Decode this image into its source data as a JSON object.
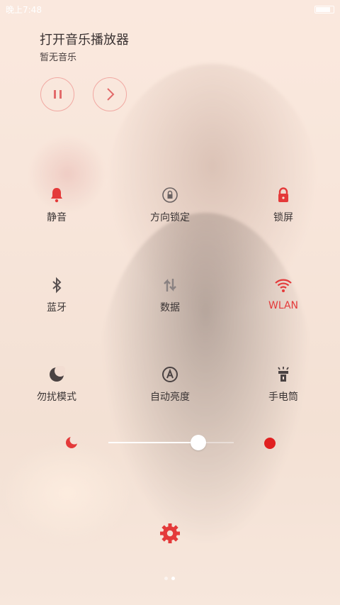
{
  "status_bar": {
    "time": "晚上7:48"
  },
  "music": {
    "title": "打开音乐播放器",
    "subtitle": "暂无音乐",
    "pause_icon": "pause-icon",
    "next_icon": "chevron-right-icon"
  },
  "tiles": [
    {
      "label": "静音",
      "icon": "bell-icon",
      "active": false
    },
    {
      "label": "方向锁定",
      "icon": "rotation-lock-icon",
      "active": false
    },
    {
      "label": "锁屏",
      "icon": "lock-icon",
      "active": false
    },
    {
      "label": "蓝牙",
      "icon": "bluetooth-icon",
      "active": false
    },
    {
      "label": "数据",
      "icon": "mobile-data-icon",
      "active": false
    },
    {
      "label": "WLAN",
      "icon": "wifi-icon",
      "active": true
    },
    {
      "label": "勿扰模式",
      "icon": "moon-icon",
      "active": false
    },
    {
      "label": "自动亮度",
      "icon": "auto-brightness-icon",
      "active": false
    },
    {
      "label": "手电筒",
      "icon": "flashlight-icon",
      "active": false
    }
  ],
  "brightness": {
    "level": 0.5,
    "min_icon": "moon-icon",
    "max_icon": "sun-icon"
  },
  "pager": {
    "pages": 2,
    "current": 2
  },
  "colors": {
    "accent": "#e43a3a",
    "text": "#3a3434",
    "icon": "#5a5252"
  }
}
